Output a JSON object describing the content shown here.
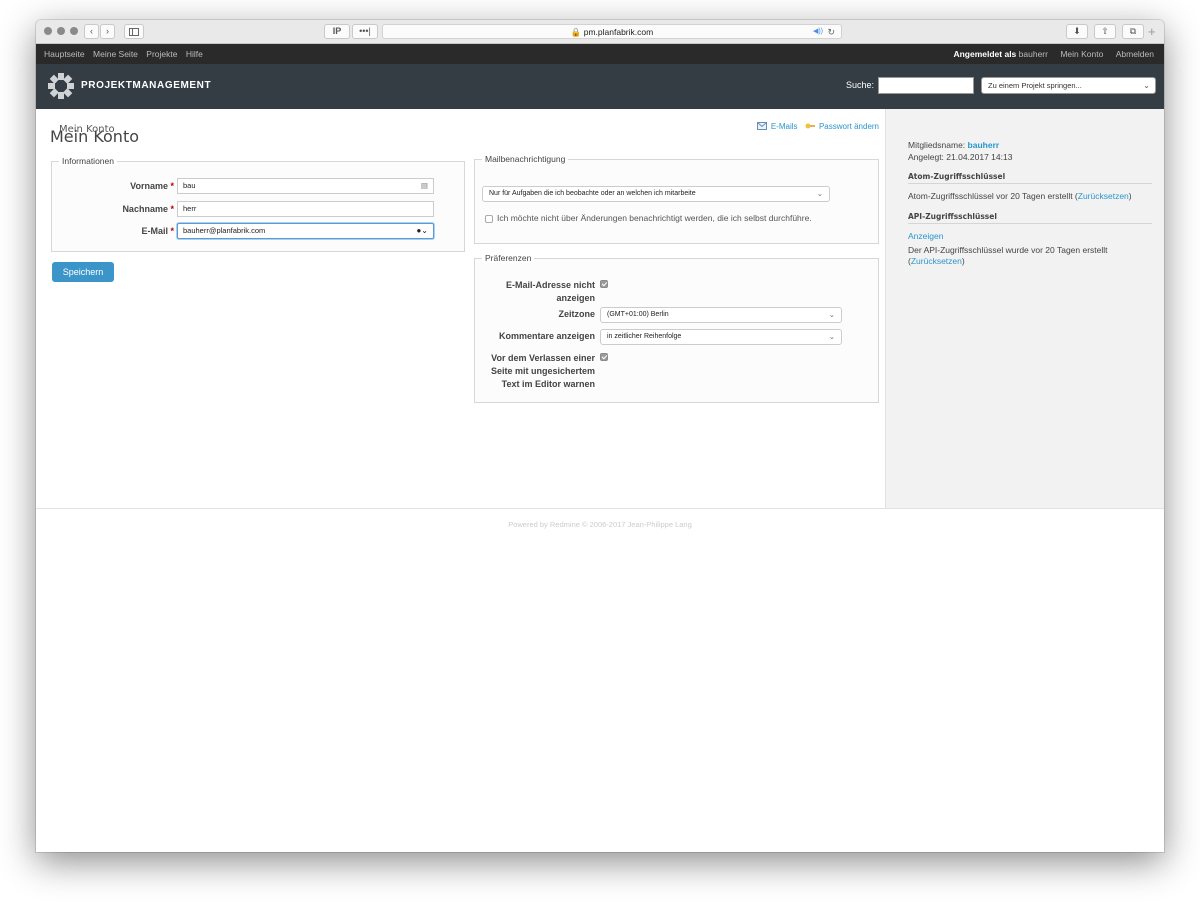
{
  "browser": {
    "url": "pm.planfabrik.com",
    "ip_label": "IP",
    "dots_label": "•••|"
  },
  "topmenu": {
    "items": [
      "Hauptseite",
      "Meine Seite",
      "Projekte",
      "Hilfe"
    ],
    "logged_in_prefix": "Angemeldet als",
    "logged_in_user": "bauherr",
    "my_account": "Mein Konto",
    "logout": "Abmelden"
  },
  "header": {
    "brand": "PROJEKTMANAGEMENT",
    "search_label": "Suche:",
    "jump_placeholder": "Zu einem Projekt springen..."
  },
  "page": {
    "title": "Mein Konto",
    "emails_link": "E-Mails",
    "password_link": "Passwort ändern"
  },
  "info": {
    "legend": "Informationen",
    "firstname_label": "Vorname",
    "firstname_value": "bau",
    "lastname_label": "Nachname",
    "lastname_value": "herr",
    "email_label": "E-Mail",
    "email_value": "bauherr@planfabrik.com",
    "required_mark": "*"
  },
  "save_button": "Speichern",
  "mail": {
    "legend": "Mailbenachrichtigung",
    "option_selected": "Nur für Aufgaben die ich beobachte oder an welchen ich mitarbeite",
    "self_notify_label": "Ich möchte nicht über Änderungen benachrichtigt werden, die ich selbst durchführe.",
    "self_notify_checked": false
  },
  "prefs": {
    "legend": "Präferenzen",
    "hide_mail_label_1": "E-Mail-Adresse nicht",
    "hide_mail_label_2": "anzeigen",
    "hide_mail_checked": true,
    "timezone_label": "Zeitzone",
    "timezone_value": "(GMT+01:00) Berlin",
    "comments_label": "Kommentare anzeigen",
    "comments_value": "in zeitlicher Reihenfolge",
    "warn_label_1": "Vor dem Verlassen einer",
    "warn_label_2": "Seite mit ungesichertem",
    "warn_label_3": "Text im Editor warnen",
    "warn_checked": true
  },
  "sidebar": {
    "title": "Mein Konto",
    "member_prefix": "Mitgliedsname:",
    "member_name": "bauherr",
    "created": "Angelegt: 21.04.2017 14:13",
    "atom_heading": "Atom-Zugriffsschlüssel",
    "atom_text": "Atom-Zugriffsschlüssel vor 20 Tagen erstellt (",
    "atom_reset": "Zurücksetzen",
    "close_paren": ")",
    "api_heading": "API-Zugriffsschlüssel",
    "api_show": "Anzeigen",
    "api_text": "Der API-Zugriffsschlüssel wurde vor 20 Tagen erstellt",
    "open_paren": "(",
    "api_reset": "Zurücksetzen"
  },
  "footer": "Powered by Redmine © 2006-2017 Jean-Philippe Lang"
}
